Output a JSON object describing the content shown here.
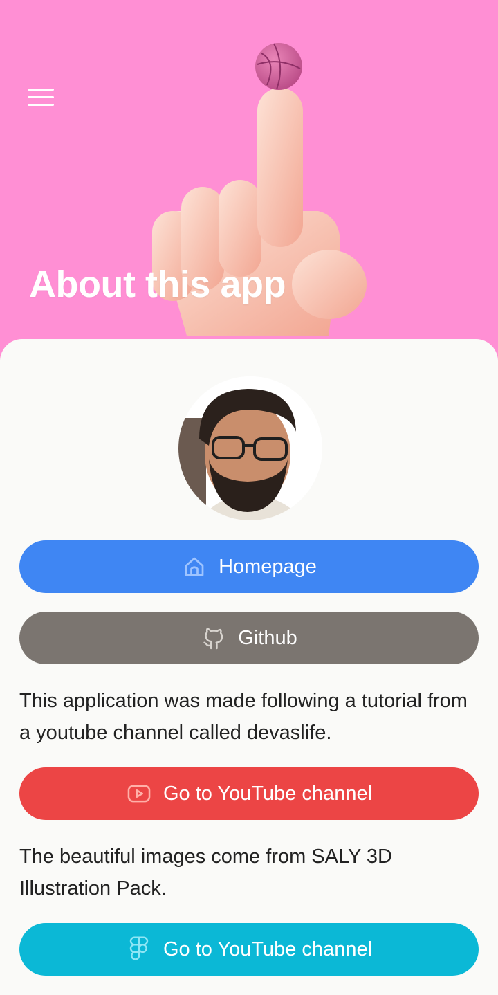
{
  "hero": {
    "title": "About this app",
    "background": "#ff8fd4",
    "menu_icon": "hamburger-menu-icon",
    "illustration": "3d-hand-balancing-ball"
  },
  "profile": {
    "avatar": "developer-avatar-photo"
  },
  "buttons": {
    "homepage": {
      "label": "Homepage",
      "icon": "home-icon",
      "color": "#3f86f3"
    },
    "github": {
      "label": "Github",
      "icon": "github-icon",
      "color": "#7b7570"
    },
    "youtube": {
      "label": "Go to YouTube channel",
      "icon": "youtube-icon",
      "color": "#ec4545"
    },
    "figma": {
      "label": "Go to YouTube channel",
      "icon": "figma-icon",
      "color": "#0bb8d6"
    }
  },
  "texts": {
    "tutorial": "This application was made following a tutorial from a youtube channel called devaslife.",
    "images_credit": "The beautiful images come from SALY 3D Illustration Pack."
  }
}
